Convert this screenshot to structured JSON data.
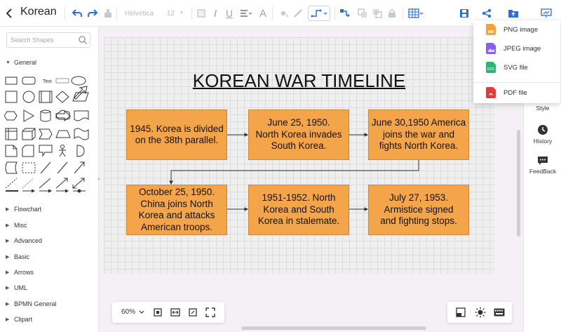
{
  "toolbar": {
    "doc_title": "Korean \\",
    "font_family": "Helvetica",
    "font_size": "12"
  },
  "sidebar": {
    "search_placeholder": "Search Shapes",
    "general_label": "General",
    "text_shape_label": "Text",
    "sections": [
      "Flowchart",
      "Misc",
      "Advanced",
      "Basic",
      "Arrows",
      "UML",
      "BPMN General",
      "Clipart"
    ]
  },
  "diagram": {
    "title": "KOREAN WAR TIMELINE",
    "boxes": [
      "1945. Korea is divided on the 38th parallel.",
      "June 25, 1950. North Korea invades South Korea.",
      "June 30,1950 America joins the war and fights North Korea.",
      "October 25, 1950. China joins North Korea and attacks American troops.",
      "1951-1952. North Korea and South Korea in stalemate.",
      "July 27, 1953. Armistice signed and fighting stops."
    ]
  },
  "right_panel": {
    "style": "Style",
    "history": "History",
    "feedback": "FeedBack"
  },
  "export_menu": {
    "items": [
      "PNG image",
      "JPEG image",
      "SVG file",
      "PDF file"
    ],
    "svg_icon_text": "SVG"
  },
  "zoom": {
    "level": "60%"
  },
  "colors": {
    "accent": "#2c6fd6",
    "box_fill": "#f4a54a"
  }
}
